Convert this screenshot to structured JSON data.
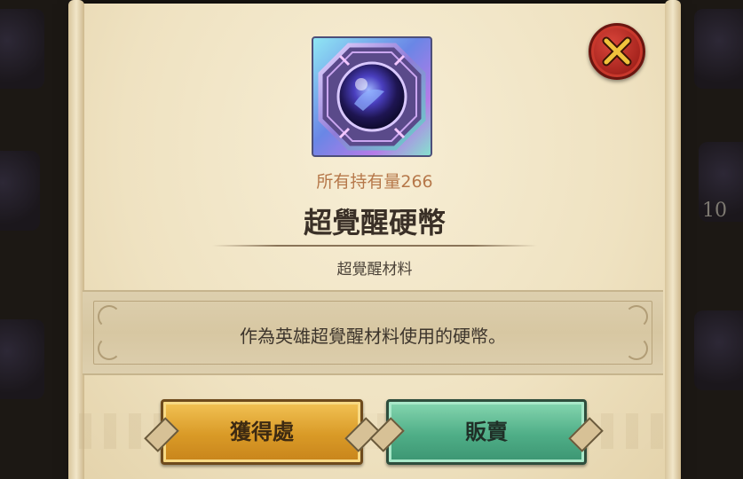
{
  "item": {
    "owned_text": "所有持有量266",
    "name": "超覺醒硬幣",
    "category": "超覺醒材料",
    "description": "作為英雄超覺醒材料使用的硬幣。",
    "icon": "awakening-coin-icon"
  },
  "dialog": {
    "close_icon": "close-icon"
  },
  "actions": {
    "source_label": "獲得處",
    "sell_label": "販賣"
  },
  "background": {
    "visible_number": "10"
  },
  "colors": {
    "parchment": "#efe2c1",
    "owned_text": "#b6784a",
    "close_red": "#a3221c",
    "source_gold": "#d99a27",
    "sell_green": "#4fae87"
  }
}
